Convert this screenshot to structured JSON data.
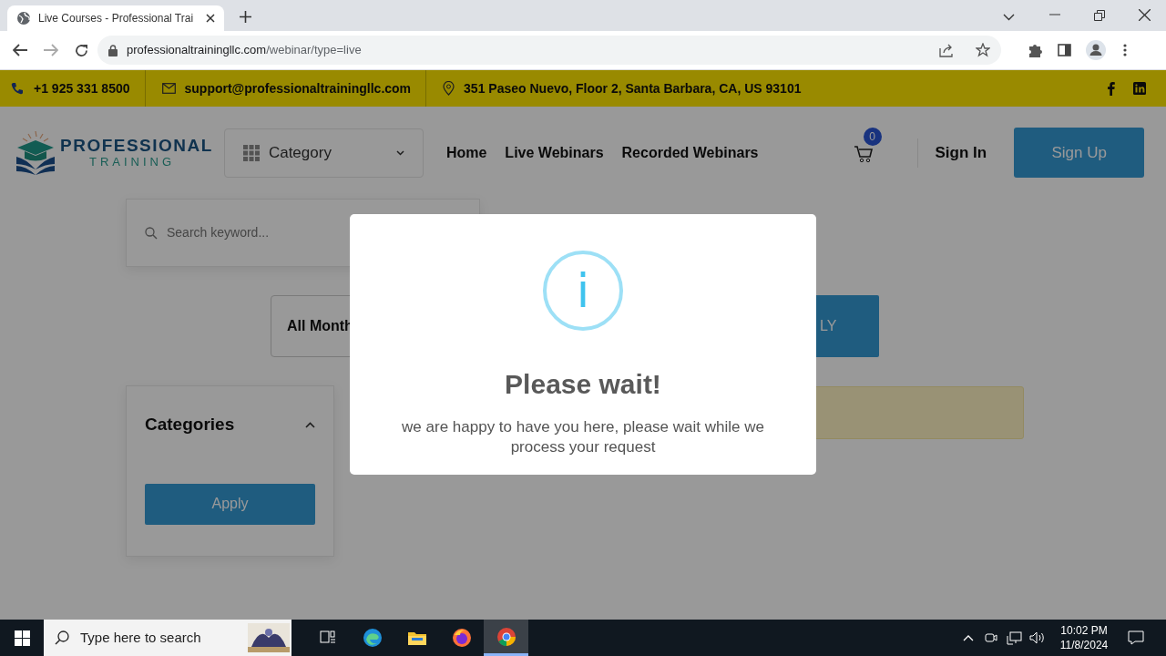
{
  "browser": {
    "tab_title": "Live Courses - Professional Trai",
    "url_domain": "professionaltrainingllc.com",
    "url_path": "/webinar/type=live"
  },
  "topbar": {
    "phone": "+1 925 331 8500",
    "email": "support@professionaltrainingllc.com",
    "address": "351 Paseo Nuevo, Floor 2, Santa Barbara, CA, US 93101"
  },
  "header": {
    "logo_line1": "PROFESSIONAL",
    "logo_line2": "TRAINING",
    "category": "Category",
    "nav": [
      {
        "label": "Home"
      },
      {
        "label": "Live Webinars"
      },
      {
        "label": "Recorded Webinars"
      }
    ],
    "cart_count": "0",
    "sign_in": "Sign In",
    "sign_up": "Sign Up"
  },
  "search": {
    "placeholder": "Search keyword..."
  },
  "filter": {
    "month": "All Month",
    "apply": "LY"
  },
  "categories": {
    "title": "Categories",
    "expanded": true,
    "button": "Apply"
  },
  "modal": {
    "title": "Please wait!",
    "message": "we are happy to have you here, please wait while we process your request",
    "icon": "i"
  },
  "taskbar": {
    "search_placeholder": "Type here to search",
    "apps": [
      {
        "kind": "taskview",
        "active": false
      },
      {
        "kind": "edge",
        "active": false
      },
      {
        "kind": "explorer",
        "active": false
      },
      {
        "kind": "firefox",
        "active": false
      },
      {
        "kind": "chrome",
        "active": true
      }
    ],
    "time": "10:02 PM",
    "date": "11/8/2024"
  }
}
